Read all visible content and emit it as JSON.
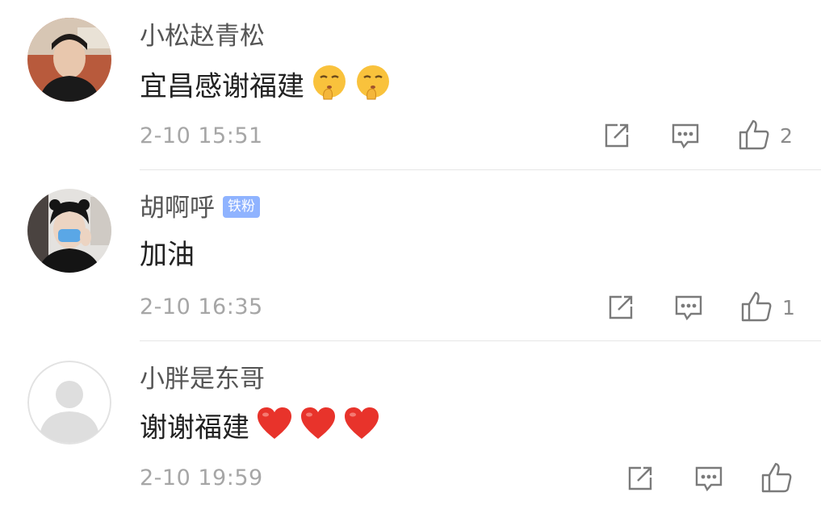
{
  "comments": [
    {
      "username": "小松赵青松",
      "text": "宜昌感谢福建",
      "emojis": [
        "shush-face-emoji",
        "shush-face-emoji"
      ],
      "time": "2-10 15:51",
      "likes": "2"
    },
    {
      "username": "胡啊呼",
      "badge": "铁粉",
      "text": "加油",
      "time": "2-10 16:35",
      "likes": "1"
    },
    {
      "username": "小胖是东哥",
      "text": "谢谢福建",
      "emojis": [
        "red-heart-emoji",
        "red-heart-emoji",
        "red-heart-emoji"
      ],
      "time": "2-10 19:59",
      "likes": ""
    }
  ],
  "icons": {
    "share": "share-icon",
    "reply": "comment-icon",
    "like": "thumbs-up-icon"
  },
  "colors": {
    "username": "#555555",
    "badge": "#8fb3ff",
    "meta": "#a6a6a6",
    "heart": "#e8332b"
  }
}
